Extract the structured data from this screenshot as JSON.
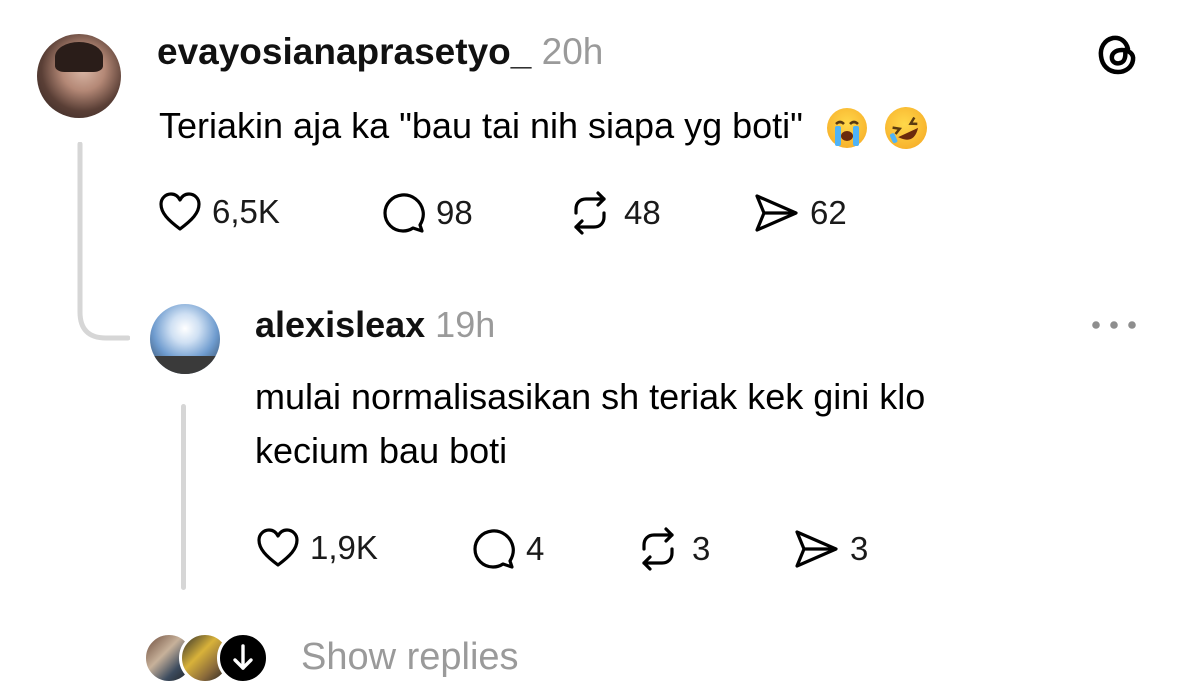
{
  "post": {
    "username": "evayosianaprasetyo_",
    "time": "20h",
    "text": "Teriakin aja ka \"bau tai nih siapa yg boti\"",
    "emojis": [
      "loudly-crying-face",
      "rolling-on-floor-laughing"
    ],
    "likes": "6,5K",
    "replies": "98",
    "reposts": "48",
    "shares": "62"
  },
  "reply": {
    "username": "alexisleax",
    "time": "19h",
    "text_line1": "mulai normalisasikan sh teriak kek gini klo",
    "text_line2": "kecium bau boti",
    "likes": "1,9K",
    "replies": "4",
    "reposts": "3",
    "shares": "3"
  },
  "footer": {
    "show_replies": "Show replies"
  },
  "icons": {
    "app_logo": "threads-logo-icon",
    "more": "more-options-icon",
    "like": "heart-icon",
    "comment": "comment-icon",
    "repost": "repost-icon",
    "share": "send-icon",
    "expand": "arrow-down-icon"
  },
  "colors": {
    "text": "#000000",
    "muted": "#9a9a9a",
    "thread_line": "#d6d6d6"
  }
}
